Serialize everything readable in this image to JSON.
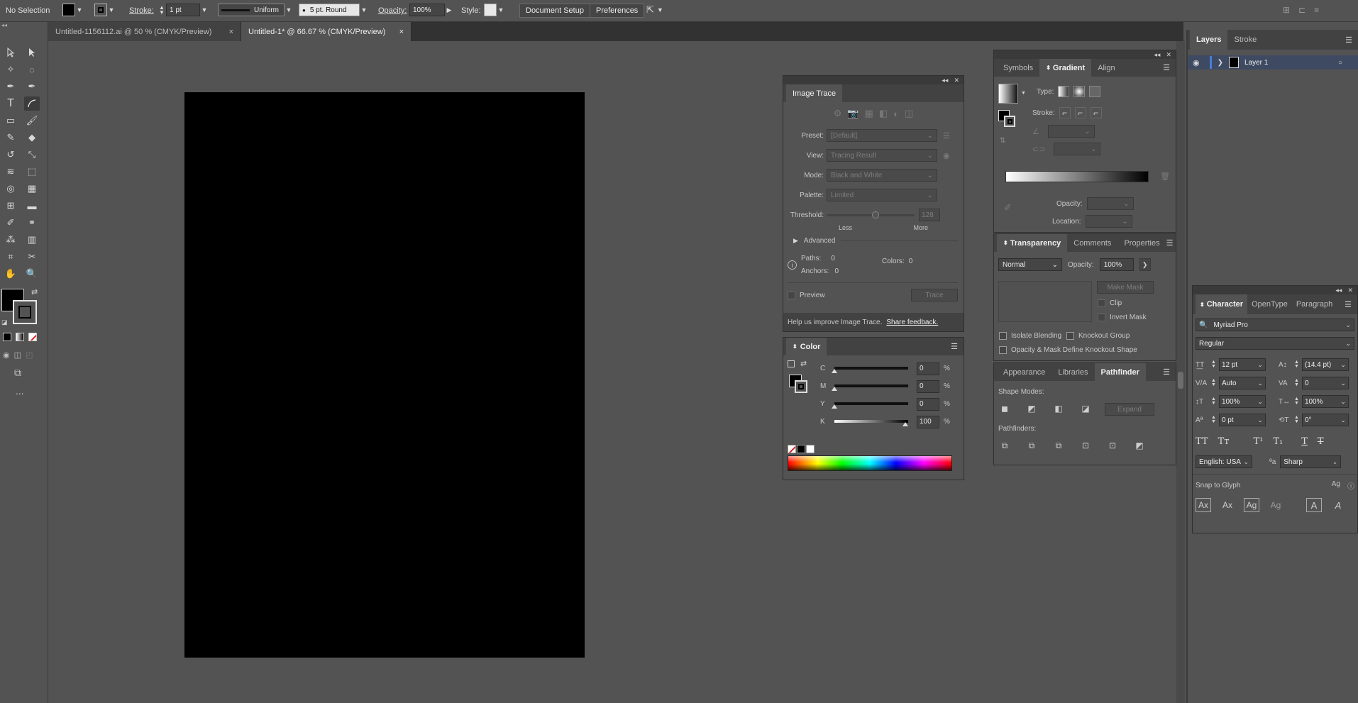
{
  "control_bar": {
    "selection": "No Selection",
    "stroke_label": "Stroke:",
    "stroke_value": "1 pt",
    "profile": "Uniform",
    "brush": "5 pt. Round",
    "opacity_label": "Opacity:",
    "opacity_value": "100%",
    "style_label": "Style:",
    "document_setup": "Document Setup",
    "preferences": "Preferences"
  },
  "doc_tabs": [
    {
      "title": "Untitled-1156112.ai @ 50 % (CMYK/Preview)",
      "close": "×"
    },
    {
      "title": "Untitled-1* @ 66.67 % (CMYK/Preview)",
      "close": "×"
    }
  ],
  "toolbar": {
    "more": "..."
  },
  "image_trace": {
    "title": "Image Trace",
    "preset_label": "Preset:",
    "preset_value": "[Default]",
    "view_label": "View:",
    "view_value": "Tracing Result",
    "mode_label": "Mode:",
    "mode_value": "Black and White",
    "palette_label": "Palette:",
    "palette_value": "Limited",
    "threshold_label": "Threshold:",
    "threshold_value": "128",
    "less": "Less",
    "more": "More",
    "advanced": "Advanced",
    "paths_label": "Paths:",
    "paths_value": "0",
    "colors_label": "Colors:",
    "colors_value": "0",
    "anchors_label": "Anchors:",
    "anchors_value": "0",
    "preview": "Preview",
    "trace": "Trace",
    "help": "Help us improve Image Trace.",
    "feedback": "Share feedback."
  },
  "color_panel": {
    "title": "Color",
    "channels": [
      {
        "name": "C",
        "value": "0",
        "unit": "%"
      },
      {
        "name": "M",
        "value": "0",
        "unit": "%"
      },
      {
        "name": "Y",
        "value": "0",
        "unit": "%"
      },
      {
        "name": "K",
        "value": "100",
        "unit": "%"
      }
    ]
  },
  "gradient_panel": {
    "tabs": [
      "Symbols",
      "Gradient",
      "Align"
    ],
    "type_label": "Type:",
    "stroke_label": "Stroke:",
    "opacity_label": "Opacity:",
    "location_label": "Location:"
  },
  "transparency_panel": {
    "tabs": [
      "Transparency",
      "Comments",
      "Properties"
    ],
    "blend_mode": "Normal",
    "opacity_label": "Opacity:",
    "opacity_value": "100%",
    "make_mask": "Make Mask",
    "clip": "Clip",
    "invert_mask": "Invert Mask",
    "isolate": "Isolate Blending",
    "knockout": "Knockout Group",
    "define_knockout": "Opacity & Mask Define Knockout Shape"
  },
  "pathfinder_panel": {
    "tabs": [
      "Appearance",
      "Libraries",
      "Pathfinder"
    ],
    "shape_modes": "Shape Modes:",
    "expand": "Expand",
    "pathfinders": "Pathfinders:"
  },
  "layers_panel": {
    "tabs": [
      "Layers",
      "Stroke"
    ],
    "layer_name": "Layer 1"
  },
  "character_panel": {
    "tabs": [
      "Character",
      "OpenType",
      "Paragraph"
    ],
    "font": "Myriad Pro",
    "style": "Regular",
    "size": "12 pt",
    "leading": "(14.4 pt)",
    "kerning": "Auto",
    "tracking": "0",
    "vscale": "100%",
    "hscale": "100%",
    "baseline": "0 pt",
    "rotation": "0°",
    "language": "English: USA",
    "aa": "Sharp",
    "snap": "Snap to Glyph"
  },
  "colors": {
    "accent": "#4b7bd5",
    "annotation": "#e0302b"
  }
}
